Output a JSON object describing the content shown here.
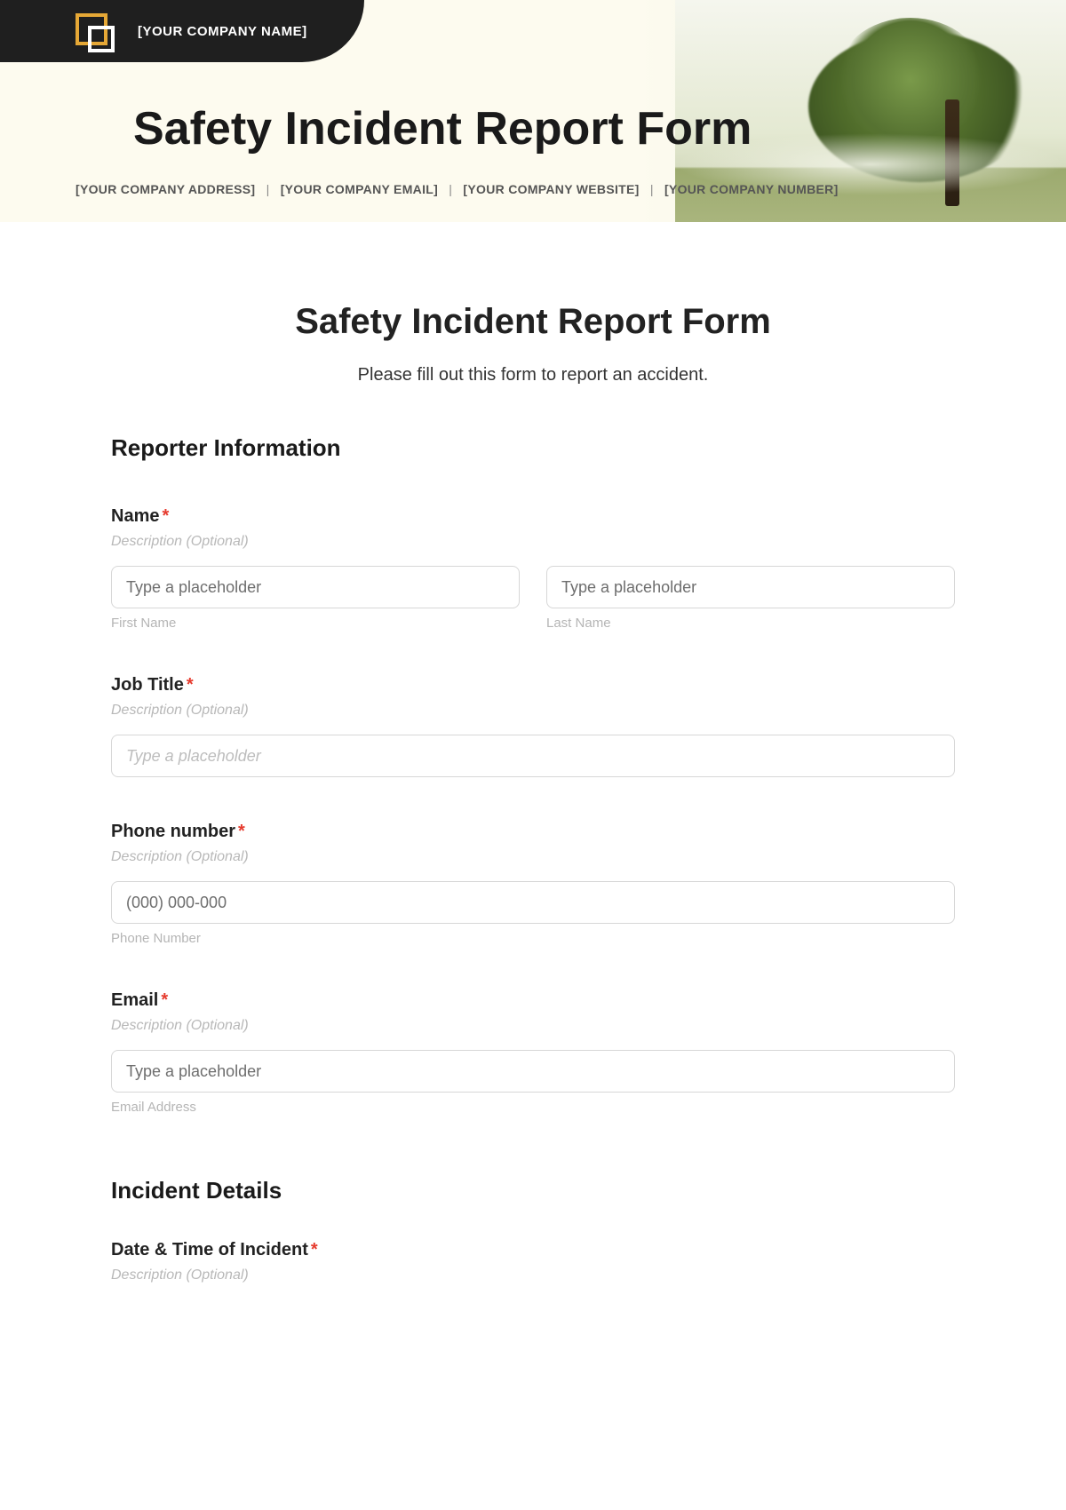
{
  "banner": {
    "company_name": "[YOUR COMPANY NAME]",
    "title": "Safety Incident Report Form",
    "meta": {
      "address": "[YOUR COMPANY ADDRESS]",
      "email": "[YOUR COMPANY EMAIL]",
      "website": "[YOUR COMPANY WEBSITE]",
      "number": "[YOUR COMPANY NUMBER]",
      "sep": "|"
    }
  },
  "form": {
    "title": "Safety Incident Report Form",
    "subtitle": "Please fill out this form to report an accident.",
    "description_placeholder": "Description (Optional)",
    "generic_placeholder": "Type a placeholder",
    "required_mark": "*",
    "sections": {
      "reporter": "Reporter Information",
      "incident": "Incident Details"
    },
    "fields": {
      "name": {
        "label": "Name",
        "first_ph": "Type a placeholder",
        "first_sub": "First Name",
        "last_ph": "Type a placeholder",
        "last_sub": "Last Name"
      },
      "job_title": {
        "label": "Job Title",
        "ph": "Type a placeholder"
      },
      "phone": {
        "label": "Phone number",
        "ph": "(000) 000-000",
        "sub": "Phone Number"
      },
      "email": {
        "label": "Email",
        "ph": "Type a placeholder",
        "sub": "Email Address"
      },
      "datetime": {
        "label": "Date & Time of Incident"
      }
    }
  }
}
